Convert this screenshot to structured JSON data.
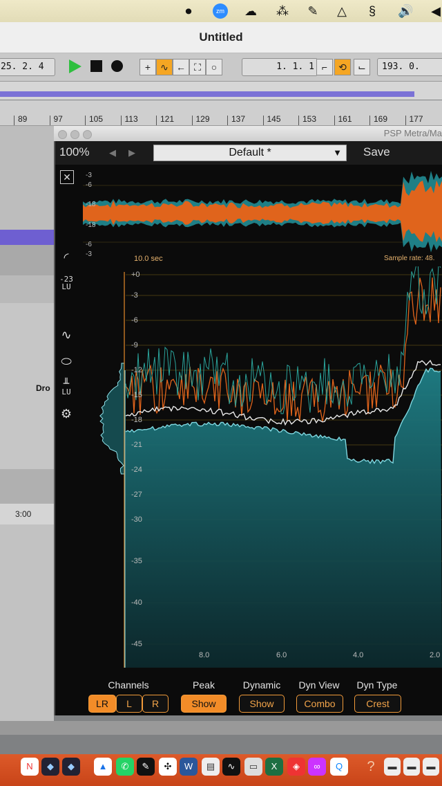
{
  "window": {
    "title": "Untitled"
  },
  "transport": {
    "position": "25. 2. 4",
    "loop_start": "1. 1. 1",
    "loop_length": "193. 0."
  },
  "ruler": {
    "bars": [
      "89",
      "97",
      "105",
      "113",
      "121",
      "129",
      "137",
      "145",
      "153",
      "161",
      "169",
      "177"
    ]
  },
  "arrangement": {
    "track_label": "Dro",
    "time_label": "3:00"
  },
  "plugin": {
    "title": "PSP Metra/Ma",
    "zoom": "100%",
    "preset": "Default *",
    "save_label": "Save",
    "lu_badge_value": "-23",
    "lu_badge_unit": "LU",
    "lu_icon_unit": "LU",
    "waveform": {
      "scale_top": [
        "-3",
        "-6",
        "-18"
      ],
      "scale_bottom": [
        "-18",
        "-6",
        "-3"
      ],
      "time_window": "10.0 sec",
      "sample_rate": "Sample rate: 48."
    },
    "db_scale": [
      "+0",
      "-3",
      "-6",
      "-9",
      "-12",
      "-15",
      "-18",
      "-21",
      "-24",
      "-27",
      "-30",
      "-35",
      "-40",
      "-45"
    ],
    "time_axis": [
      "8.0",
      "6.0",
      "4.0",
      "2.0"
    ],
    "controls": {
      "channels": {
        "label": "Channels",
        "options": [
          "LR",
          "L",
          "R"
        ],
        "selected": "LR"
      },
      "peak": {
        "label": "Peak",
        "value": "Show",
        "active": true
      },
      "dynamic": {
        "label": "Dynamic",
        "value": "Show"
      },
      "dyn_view": {
        "label": "Dyn View",
        "value": "Combo"
      },
      "dyn_type": {
        "label": "Dyn Type",
        "value": "Crest"
      }
    }
  },
  "colors": {
    "accent": "#f28c28",
    "teal": "#1f7f86",
    "orange": "#e0641c"
  }
}
